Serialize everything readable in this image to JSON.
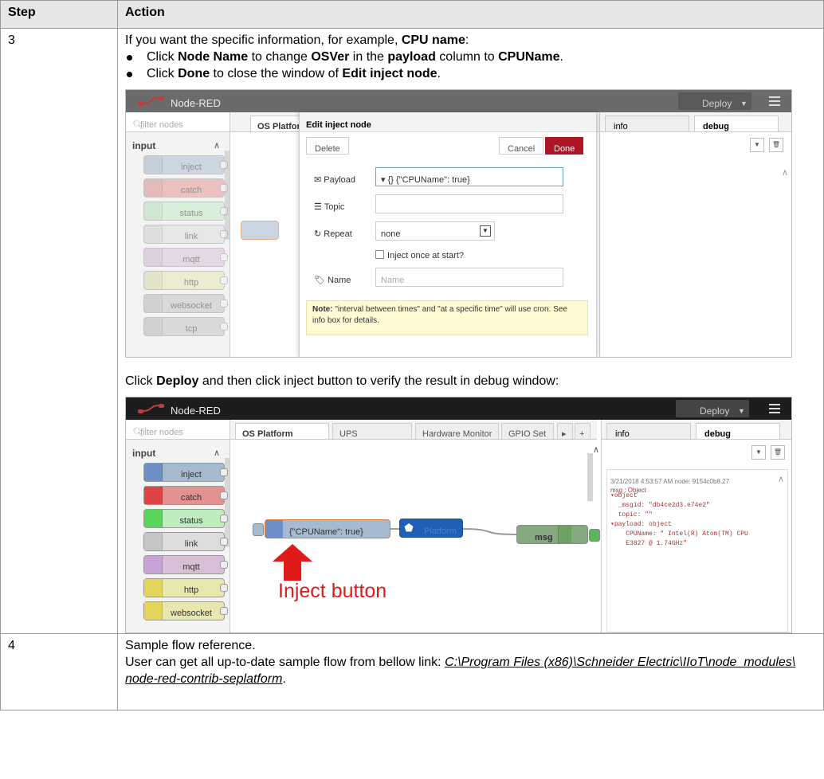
{
  "table": {
    "headers": [
      "Step",
      "Action"
    ],
    "rows": [
      {
        "step": "3",
        "intro_text": "If you want the specific information, for example, ",
        "intro_bold": "CPU name",
        "intro_end": ":",
        "bullet1": {
          "p1": "Click ",
          "b1": "Node Name",
          "p2": " to change ",
          "b2": "OSVer",
          "p3": " in the ",
          "b3": "payload",
          "p4": " column to ",
          "b4": "CPUName",
          "p5": "."
        },
        "bullet2": {
          "p1": "Click ",
          "b1": "Done",
          "p2": " to close the window of ",
          "b2": "Edit inject node",
          "p3": "."
        },
        "deploy_text": {
          "p1": "Click ",
          "b1": "Deploy",
          "p2": " and then click inject button to verify the result in debug window:"
        }
      },
      {
        "step": "4",
        "line1": "Sample flow reference.",
        "line2": "User can get all up-to-date sample flow from bellow link: ",
        "link": "C:\\Program Files (x86)\\Schneider Electric\\IIoT\\node_modules\\ node-red-contrib-seplatform",
        "line2_end": "."
      }
    ]
  },
  "screenshot1": {
    "app_title": "Node-RED",
    "deploy": "Deploy",
    "filter_placeholder": "filter nodes",
    "category": "input",
    "palette_nodes": [
      "inject",
      "catch",
      "status",
      "link",
      "mqtt",
      "http",
      "websocket",
      "tcp"
    ],
    "workspace_tab": "OS Platform",
    "tray_title": "Edit inject node",
    "delete": "Delete",
    "cancel": "Cancel",
    "done": "Done",
    "fields": {
      "payload_label": "Payload",
      "payload_value": "{} {\"CPUName\": true}",
      "topic_label": "Topic",
      "repeat_label": "Repeat",
      "repeat_value": "none",
      "inject_once": "Inject once at start?",
      "name_label": "Name",
      "name_placeholder": "Name"
    },
    "note_bold": "Note:",
    "note_text": " \"interval between times\" and \"at a specific time\" will use cron. See info box for details.",
    "sidebar_tabs": [
      "info",
      "debug"
    ]
  },
  "screenshot2": {
    "app_title": "Node-RED",
    "deploy": "Deploy",
    "filter_placeholder": "filter nodes",
    "category": "input",
    "palette_nodes": [
      "inject",
      "catch",
      "status",
      "link",
      "mqtt",
      "http",
      "websocket"
    ],
    "tabs": [
      "OS Platform",
      "UPS",
      "Hardware Monitor",
      "GPIO Set"
    ],
    "sidebar_tabs": [
      "info",
      "debug"
    ],
    "debug": {
      "header": "3/21/2018 4:53:57 AM  node: 9154c0b8.27",
      "msg": "msg : Object",
      "lines": [
        "▾object",
        "  _msgid: \"db4ce2d3.e74e2\"",
        "  topic: \"\"",
        "▾payload: object",
        "    CPUName: \" Intel(R) Atom(TM) CPU",
        "    E3827 @ 1.74GHz\""
      ]
    },
    "flow": {
      "inject_label": "{\"CPUName\": true}",
      "platform_label": "Platform",
      "debug_label": "msg"
    },
    "annotation": "Inject button"
  }
}
